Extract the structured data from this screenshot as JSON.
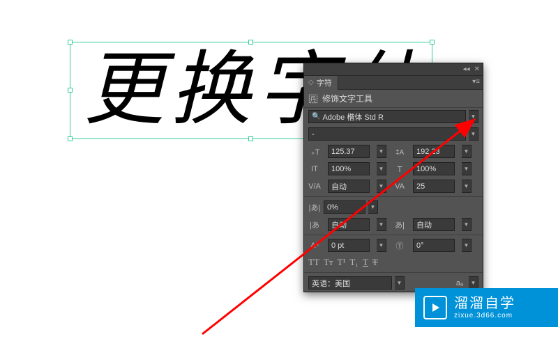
{
  "artboard_text": "更换字体",
  "panel": {
    "tab_label": "字符",
    "subtitle": "修饰文字工具",
    "font_search_placeholder": "",
    "font_name": "Adobe 楷体 Std R",
    "font_style": "-",
    "font_size": "125.37",
    "leading": "192.23",
    "vscale": "100%",
    "hscale": "100%",
    "kerning": "自动",
    "tracking": "25",
    "tsume": "0%",
    "aki_left": "自动",
    "aki_right": "自动",
    "baseline_shift": "0 pt",
    "rotation": "0°",
    "language": "英语：美国"
  },
  "watermark": {
    "line1": "溜溜自学",
    "line2": "zixue.3d66.com"
  },
  "icons": {
    "size_t": "⁠T",
    "leading_a": "A",
    "vscale": "IT",
    "hscale": "T",
    "kerning": "VA",
    "tracking": "VA",
    "tsume": "あ",
    "baseline": "Aª",
    "rotation": "T"
  }
}
